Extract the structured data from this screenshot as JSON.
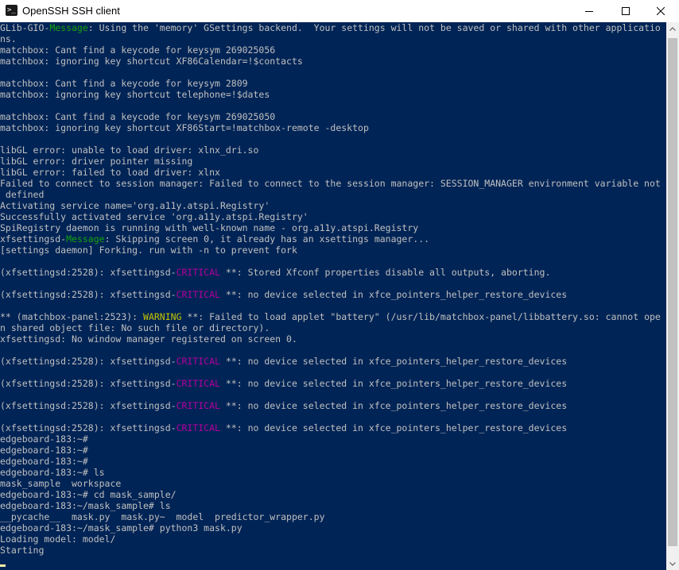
{
  "window": {
    "title": "OpenSSH SSH client",
    "icon": "terminal-icon",
    "controls": {
      "minimize": "minimize-icon",
      "maximize": "maximize-icon",
      "close": "close-icon"
    }
  },
  "colors": {
    "background": "#012456",
    "text": "#c0c0c0",
    "message": "#13a10e",
    "critical": "#b4009e",
    "warning": "#c4c400",
    "cursor": "#f9f1a5"
  },
  "terminal": {
    "lines": [
      [
        {
          "t": "GLib-GIO-"
        },
        {
          "t": "Message",
          "c": "green"
        },
        {
          "t": ": Using the 'memory' GSettings backend.  Your settings will not be saved or shared with other applicatio"
        }
      ],
      [
        {
          "t": "ns."
        }
      ],
      [
        {
          "t": "matchbox: Cant find a keycode for keysym 269025056"
        }
      ],
      [
        {
          "t": "matchbox: ignoring key shortcut XF86Calendar=!$contacts"
        }
      ],
      [
        {
          "t": ""
        }
      ],
      [
        {
          "t": "matchbox: Cant find a keycode for keysym 2809"
        }
      ],
      [
        {
          "t": "matchbox: ignoring key shortcut telephone=!$dates"
        }
      ],
      [
        {
          "t": ""
        }
      ],
      [
        {
          "t": "matchbox: Cant find a keycode for keysym 269025050"
        }
      ],
      [
        {
          "t": "matchbox: ignoring key shortcut XF86Start=!matchbox-remote -desktop"
        }
      ],
      [
        {
          "t": ""
        }
      ],
      [
        {
          "t": "libGL error: unable to load driver: xlnx_dri.so"
        }
      ],
      [
        {
          "t": "libGL error: driver pointer missing"
        }
      ],
      [
        {
          "t": "libGL error: failed to load driver: xlnx"
        }
      ],
      [
        {
          "t": "Failed to connect to session manager: Failed to connect to the session manager: SESSION_MANAGER environment variable not"
        }
      ],
      [
        {
          "t": " defined"
        }
      ],
      [
        {
          "t": "Activating service name='org.a11y.atspi.Registry'"
        }
      ],
      [
        {
          "t": "Successfully activated service 'org.a11y.atspi.Registry'"
        }
      ],
      [
        {
          "t": "SpiRegistry daemon is running with well-known name - org.a11y.atspi.Registry"
        }
      ],
      [
        {
          "t": "xfsettingsd-"
        },
        {
          "t": "Message",
          "c": "green"
        },
        {
          "t": ": Skipping screen 0, it already has an xsettings manager..."
        }
      ],
      [
        {
          "t": "[settings daemon] Forking. run with -n to prevent fork"
        }
      ],
      [
        {
          "t": ""
        }
      ],
      [
        {
          "t": "(xfsettingsd:2528): xfsettingsd-"
        },
        {
          "t": "CRITICAL",
          "c": "magenta"
        },
        {
          "t": " **: Stored Xfconf properties disable all outputs, aborting."
        }
      ],
      [
        {
          "t": ""
        }
      ],
      [
        {
          "t": "(xfsettingsd:2528): xfsettingsd-"
        },
        {
          "t": "CRITICAL",
          "c": "magenta"
        },
        {
          "t": " **: no device selected in xfce_pointers_helper_restore_devices"
        }
      ],
      [
        {
          "t": ""
        }
      ],
      [
        {
          "t": "** (matchbox-panel:2523): "
        },
        {
          "t": "WARNING",
          "c": "yellow"
        },
        {
          "t": " **: Failed to load applet \"battery\" (/usr/lib/matchbox-panel/libbattery.so: cannot ope"
        }
      ],
      [
        {
          "t": "n shared object file: No such file or directory)."
        }
      ],
      [
        {
          "t": "xfsettingsd: No window manager registered on screen 0."
        }
      ],
      [
        {
          "t": ""
        }
      ],
      [
        {
          "t": "(xfsettingsd:2528): xfsettingsd-"
        },
        {
          "t": "CRITICAL",
          "c": "magenta"
        },
        {
          "t": " **: no device selected in xfce_pointers_helper_restore_devices"
        }
      ],
      [
        {
          "t": ""
        }
      ],
      [
        {
          "t": "(xfsettingsd:2528): xfsettingsd-"
        },
        {
          "t": "CRITICAL",
          "c": "magenta"
        },
        {
          "t": " **: no device selected in xfce_pointers_helper_restore_devices"
        }
      ],
      [
        {
          "t": ""
        }
      ],
      [
        {
          "t": "(xfsettingsd:2528): xfsettingsd-"
        },
        {
          "t": "CRITICAL",
          "c": "magenta"
        },
        {
          "t": " **: no device selected in xfce_pointers_helper_restore_devices"
        }
      ],
      [
        {
          "t": ""
        }
      ],
      [
        {
          "t": "(xfsettingsd:2528): xfsettingsd-"
        },
        {
          "t": "CRITICAL",
          "c": "magenta"
        },
        {
          "t": " **: no device selected in xfce_pointers_helper_restore_devices"
        }
      ],
      [
        {
          "t": "edgeboard-183:~#"
        }
      ],
      [
        {
          "t": "edgeboard-183:~#"
        }
      ],
      [
        {
          "t": "edgeboard-183:~#"
        }
      ],
      [
        {
          "t": "edgeboard-183:~# ls"
        }
      ],
      [
        {
          "t": "mask_sample  workspace"
        }
      ],
      [
        {
          "t": "edgeboard-183:~# cd mask_sample/"
        }
      ],
      [
        {
          "t": "edgeboard-183:~/mask_sample# ls"
        }
      ],
      [
        {
          "t": "__pycache__  mask.py  mask.py~  model  predictor_wrapper.py"
        }
      ],
      [
        {
          "t": "edgeboard-183:~/mask_sample# python3 mask.py"
        }
      ],
      [
        {
          "t": "Loading model: model/"
        }
      ],
      [
        {
          "t": "Starting"
        }
      ]
    ]
  }
}
